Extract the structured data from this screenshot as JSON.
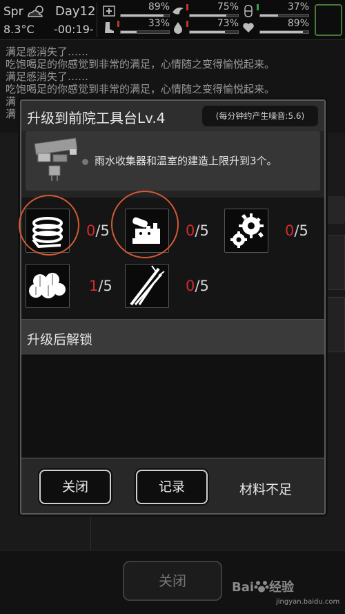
{
  "topbar": {
    "season": "Spr",
    "temperature": "8.3°C",
    "day": "Day12",
    "time": "-00:19-",
    "stats": [
      {
        "icon": "health-cross-icon",
        "value": "89%",
        "level": 0.89
      },
      {
        "icon": "bird-icon",
        "value": "75%",
        "level": 0.75
      },
      {
        "icon": "bandage-icon",
        "value": "37%",
        "level": 0.37
      },
      {
        "icon": "boot-icon",
        "value": "33%",
        "level": 0.33
      },
      {
        "icon": "water-drop-icon",
        "value": "73%",
        "level": 0.73
      },
      {
        "icon": "heart-icon",
        "value": "89%",
        "level": 0.89
      }
    ]
  },
  "log": {
    "lines": [
      "满足感消失了……",
      "吃饱喝足的你感觉到非常的满足，心情随之变得愉悦起来。",
      "满足感消失了……",
      "吃饱喝足的你感觉到非常的满足，心情随之变得愉悦起来。",
      "满",
      "满"
    ]
  },
  "background": {
    "close_label": "关闭"
  },
  "dialog": {
    "title": "升级到前院工具台Lv.4",
    "noise": "(每分钟约产生噪音:5.6)",
    "description": "雨水收集器和温室的建造上限升到3个。",
    "materials": [
      {
        "name": "cloth-roll-icon",
        "have": "0",
        "need": "/5"
      },
      {
        "name": "parts-kit-icon",
        "have": "0",
        "need": "/5"
      },
      {
        "name": "gears-icon",
        "have": "0",
        "need": "/5"
      },
      {
        "name": "cotton-icon",
        "have": "1",
        "need": "/5"
      },
      {
        "name": "reed-icon",
        "have": "0",
        "need": "/5"
      }
    ],
    "unlock_title": "升级后解锁",
    "close_label": "关闭",
    "record_label": "记录",
    "status": "材料不足"
  },
  "watermark": {
    "brand": "Bai",
    "suffix": "经验",
    "site": "jingyan.baidu.com"
  }
}
